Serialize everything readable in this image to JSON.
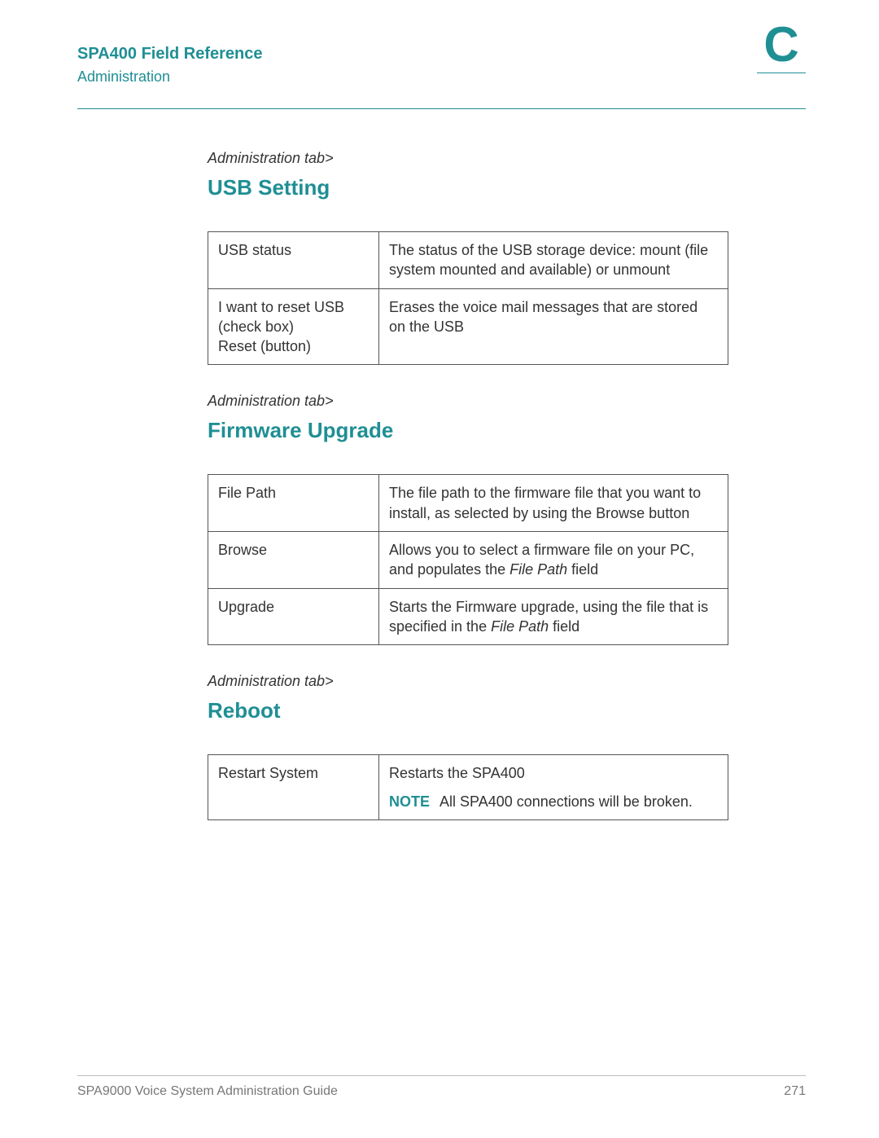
{
  "header": {
    "title": "SPA400 Field Reference",
    "subtitle": "Administration",
    "appendix_letter": "C"
  },
  "sections": [
    {
      "tab": "Administration tab>",
      "heading": "USB Setting",
      "rows": [
        {
          "field": "USB status",
          "desc_html": "The status of the USB storage device: mount (file system mounted and available) or unmount"
        },
        {
          "field": "I want to reset USB (check box)\nReset (button)",
          "desc_html": "Erases the voice mail messages that are stored on the USB"
        }
      ]
    },
    {
      "tab": "Administration tab>",
      "heading": "Firmware Upgrade",
      "rows": [
        {
          "field": "File Path",
          "desc_html": "The file path to the firmware file that you want to install, as selected by using the Browse button"
        },
        {
          "field": "Browse",
          "desc_html": "Allows you to select a firmware file on your PC, and populates the <span class=\"ital\">File Path</span> field"
        },
        {
          "field": "Upgrade",
          "desc_html": "Starts the Firmware upgrade, using the file that is specified in the <span class=\"ital\">File Path</span> field"
        }
      ]
    },
    {
      "tab": "Administration tab>",
      "heading": "Reboot",
      "rows": [
        {
          "field": "Restart System",
          "desc_html": "Restarts the SPA400<div style=\"height:10px\"></div><span class=\"note-label\">NOTE</span><span class=\"note-gap\"></span>All SPA400 connections will be broken."
        }
      ]
    }
  ],
  "footer": {
    "left": "SPA9000 Voice System Administration Guide",
    "right": "271"
  }
}
